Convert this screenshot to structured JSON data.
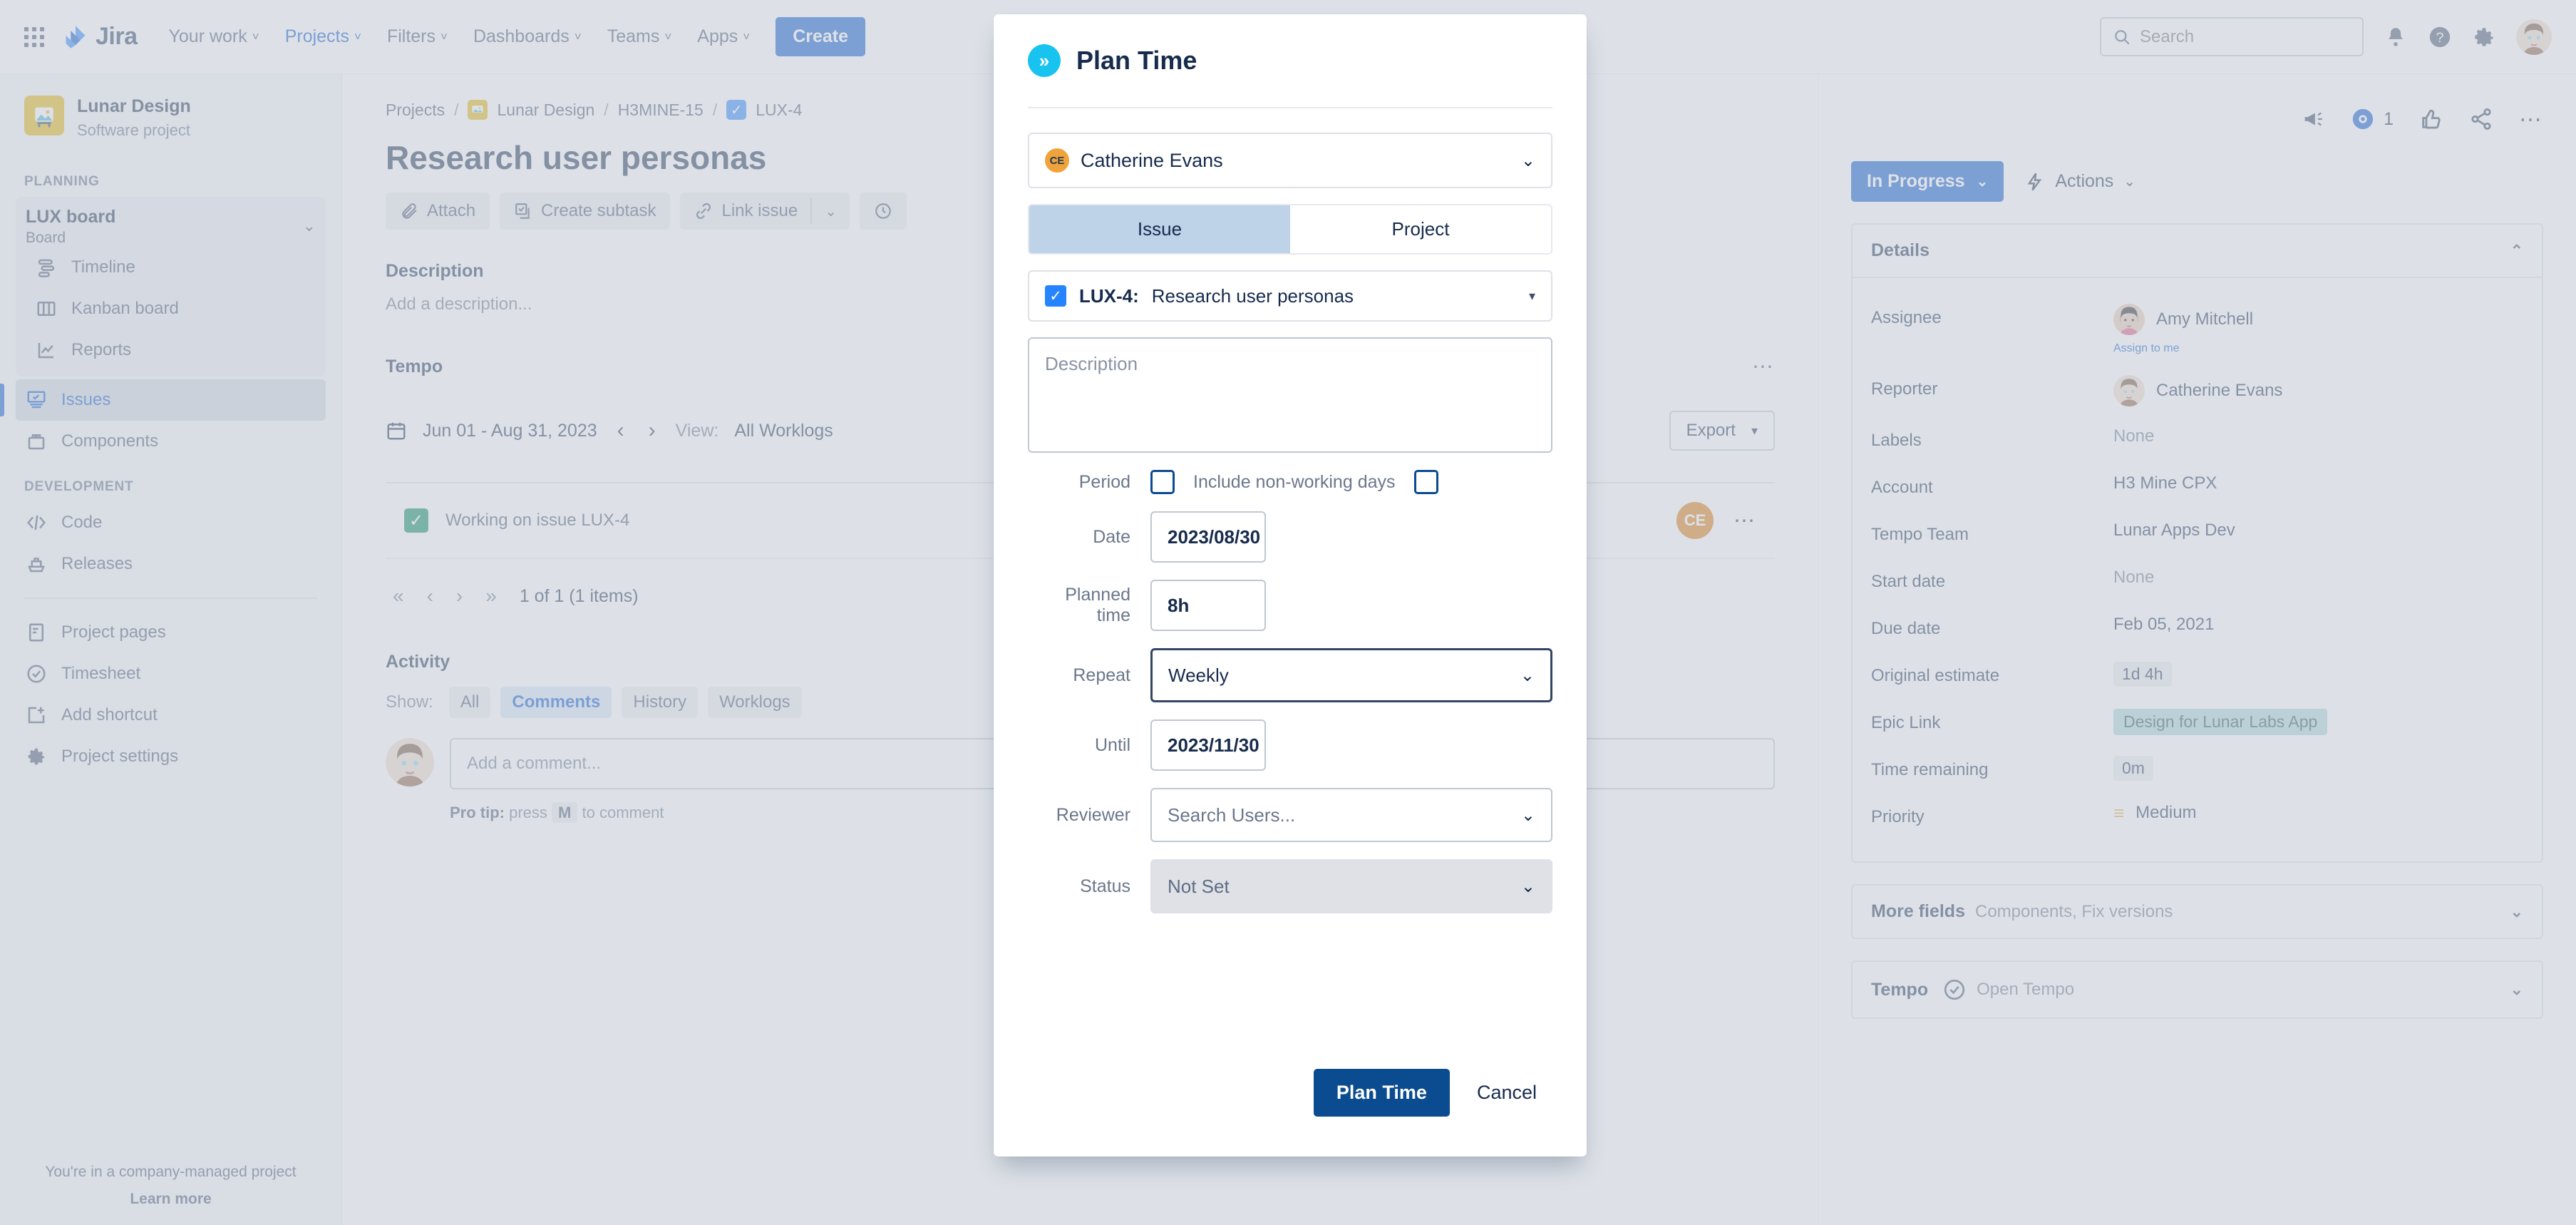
{
  "topnav": {
    "logo_text": "Jira",
    "items": [
      {
        "label": "Your work",
        "caret": "˅",
        "active": false
      },
      {
        "label": "Projects",
        "caret": "˅",
        "active": true
      },
      {
        "label": "Filters",
        "caret": "˅",
        "active": false
      },
      {
        "label": "Dashboards",
        "caret": "˅",
        "active": false
      },
      {
        "label": "Teams",
        "caret": "˅",
        "active": false
      },
      {
        "label": "Apps",
        "caret": "˅",
        "active": false
      }
    ],
    "create_label": "Create",
    "search_placeholder": "Search",
    "icons": [
      "notifications-icon",
      "help-icon",
      "settings-icon",
      "profile-avatar"
    ]
  },
  "sidebar": {
    "project_name": "Lunar Design",
    "project_type": "Software project",
    "planning_label": "PLANNING",
    "board": {
      "name": "LUX board",
      "type": "Board"
    },
    "planning_items": [
      {
        "label": "Timeline",
        "icon": "timeline-icon",
        "selected": false
      },
      {
        "label": "Kanban board",
        "icon": "board-columns-icon",
        "selected": false
      },
      {
        "label": "Reports",
        "icon": "reports-chart-icon",
        "selected": false
      },
      {
        "label": "Issues",
        "icon": "issues-icon",
        "selected": true
      },
      {
        "label": "Components",
        "icon": "components-icon",
        "selected": false
      }
    ],
    "development_label": "DEVELOPMENT",
    "development_items": [
      {
        "label": "Code",
        "icon": "code-icon",
        "selected": false
      },
      {
        "label": "Releases",
        "icon": "releases-ship-icon",
        "selected": false
      }
    ],
    "other_items": [
      {
        "label": "Project pages",
        "icon": "page-icon",
        "selected": false
      },
      {
        "label": "Timesheet",
        "icon": "timesheet-check-icon",
        "selected": false
      },
      {
        "label": "Add shortcut",
        "icon": "add-shortcut-icon",
        "selected": false
      },
      {
        "label": "Project settings",
        "icon": "gear-icon",
        "selected": false
      }
    ],
    "footer_text": "You're in a company-managed project",
    "footer_link": "Learn more"
  },
  "main": {
    "breadcrumbs": [
      {
        "label": "Projects",
        "icon": null
      },
      {
        "label": "Lunar Design",
        "icon": "project-avatar"
      },
      {
        "label": "H3MINE-15",
        "icon": null
      },
      {
        "label": "LUX-4",
        "icon": "task-check-icon"
      }
    ],
    "issue_title": "Research user personas",
    "action_buttons": [
      {
        "label": "Attach",
        "icon": "paperclip-icon"
      },
      {
        "label": "Create subtask",
        "icon": "subtask-icon"
      },
      {
        "label": "Link issue",
        "icon": "link-icon",
        "has_dropdown": true
      }
    ],
    "description_heading": "Description",
    "description_placeholder": "Add a description...",
    "tempo": {
      "heading": "Tempo",
      "date_range": "Jun 01 - Aug 31, 2023",
      "prev_arrow": "‹",
      "next_arrow": "›",
      "view_label": "View:",
      "view_value": "All Worklogs",
      "export_label": "Export"
    },
    "worklog": {
      "text": "Working on issue LUX-4",
      "avatar_initials": "CE"
    },
    "pagination": {
      "first": "«",
      "prev": "‹",
      "next": "›",
      "last": "»",
      "summary": "1 of 1 (1 items)"
    },
    "activity": {
      "heading": "Activity",
      "show_label": "Show:",
      "tabs": [
        {
          "label": "All",
          "active": false
        },
        {
          "label": "Comments",
          "active": true
        },
        {
          "label": "History",
          "active": false
        },
        {
          "label": "Worklogs",
          "active": false
        }
      ],
      "comment_placeholder": "Add a comment...",
      "protip_prefix": "Pro tip:",
      "protip_press": "press",
      "protip_key": "M",
      "protip_suffix": "to comment"
    }
  },
  "right_panel": {
    "watch_count": "1",
    "status_label": "In Progress",
    "actions_label": "Actions",
    "details_heading": "Details",
    "fields": [
      {
        "key": "Assignee",
        "value": "Amy Mitchell",
        "type": "user",
        "sublink": "Assign to me"
      },
      {
        "key": "Reporter",
        "value": "Catherine Evans",
        "type": "user"
      },
      {
        "key": "Labels",
        "value": "None",
        "type": "muted"
      },
      {
        "key": "Account",
        "value": "H3 Mine CPX",
        "type": "text"
      },
      {
        "key": "Tempo Team",
        "value": "Lunar Apps Dev",
        "type": "text"
      },
      {
        "key": "Start date",
        "value": "None",
        "type": "muted"
      },
      {
        "key": "Due date",
        "value": "Feb 05, 2021",
        "type": "text"
      },
      {
        "key": "Original estimate",
        "value": "1d 4h",
        "type": "pill"
      },
      {
        "key": "Epic Link",
        "value": "Design for Lunar Labs App",
        "type": "epic"
      },
      {
        "key": "Time remaining",
        "value": "0m",
        "type": "pill"
      },
      {
        "key": "Priority",
        "value": "Medium",
        "type": "priority"
      }
    ],
    "more_fields": {
      "label": "More fields",
      "sub": "Components, Fix versions"
    },
    "tempo_card": {
      "label": "Tempo",
      "link": "Open Tempo"
    }
  },
  "modal": {
    "title": "Plan Time",
    "logo_glyph": "»",
    "user": {
      "name": "Catherine Evans",
      "initials": "CE"
    },
    "segments": [
      {
        "label": "Issue",
        "active": true
      },
      {
        "label": "Project",
        "active": false
      }
    ],
    "issue": {
      "key": "LUX-4:",
      "summary": "Research user personas"
    },
    "description_placeholder": "Description",
    "period_label": "Period",
    "include_nonworking_label": "Include non-working days",
    "date_label": "Date",
    "date_value": "2023/08/30",
    "planned_time_label": "Planned time",
    "planned_time_value": "8h",
    "repeat_label": "Repeat",
    "repeat_value": "Weekly",
    "until_label": "Until",
    "until_value": "2023/11/30",
    "reviewer_label": "Reviewer",
    "reviewer_placeholder": "Search Users...",
    "status_label": "Status",
    "status_value": "Not Set",
    "submit_label": "Plan Time",
    "cancel_label": "Cancel"
  },
  "colors": {
    "brand_blue": "#0052cc",
    "modal_primary": "#0b4b8f",
    "tempo_cyan": "#18c3f0",
    "epic_teal": "#a7d6d6",
    "done_green": "#00875a",
    "priority_orange": "#e2a03f"
  }
}
